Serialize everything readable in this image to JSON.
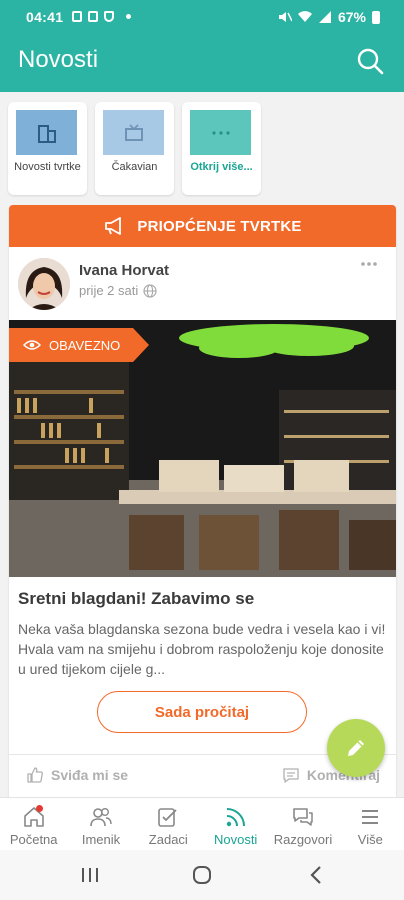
{
  "status": {
    "time": "04:41",
    "battery": "67%"
  },
  "appbar": {
    "title": "Novosti"
  },
  "categories": [
    {
      "label": "Novosti tvrtke"
    },
    {
      "label": "Čakavian"
    },
    {
      "label": "Otkrij više..."
    }
  ],
  "post": {
    "banner": "PRIOPĆENJE TVRTKE",
    "author": "Ivana Horvat",
    "time": "prije 2 sati",
    "badge": "OBAVEZNO",
    "title": "Sretni blagdani! Zabavimo se",
    "excerpt": "Neka vaša blagdanska sezona bude vedra i vesela kao i vi! Hvala vam na smijehu i dobrom raspoloženju koje donosite u ured tijekom cijele g...",
    "read_button": "Sada pročitaj",
    "like_label": "Sviđa mi se",
    "comment_label": "Komentiraj"
  },
  "bottom_nav": [
    {
      "label": "Početna",
      "icon": "home-icon"
    },
    {
      "label": "Imenik",
      "icon": "people-icon"
    },
    {
      "label": "Zadaci",
      "icon": "tasks-icon"
    },
    {
      "label": "Novosti",
      "icon": "rss-icon",
      "active": true
    },
    {
      "label": "Razgovori",
      "icon": "chat-icon"
    },
    {
      "label": "Više",
      "icon": "menu-icon"
    }
  ],
  "colors": {
    "primary": "#2bb3a3",
    "accent": "#f26a2a",
    "fab": "#b7d95a",
    "active_nav": "#1aa594"
  }
}
